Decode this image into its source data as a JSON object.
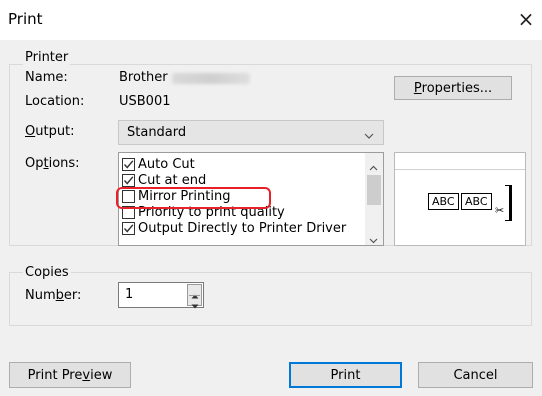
{
  "dialog": {
    "title": "Print",
    "close_glyph": "×"
  },
  "printer": {
    "group_label": "Printer",
    "name_label": "Name:",
    "name_value": "Brother",
    "location_label": "Location:",
    "location_value": "USB001",
    "properties_button": {
      "prefix": "",
      "underline": "P",
      "rest": "roperties..."
    }
  },
  "output": {
    "label": {
      "underline": "O",
      "rest": "utput:"
    },
    "selected": "Standard"
  },
  "options": {
    "label": {
      "prefix": "Op",
      "underline": "t",
      "rest": "ions:"
    },
    "items": [
      {
        "label": "Auto Cut",
        "checked": true
      },
      {
        "label": "Cut at end",
        "checked": true
      },
      {
        "label": "Mirror Printing",
        "checked": false
      },
      {
        "label": "Priority to print quality",
        "checked": false
      },
      {
        "label": "Output Directly to Printer Driver",
        "checked": true
      }
    ],
    "highlight_color": "#e8202a"
  },
  "preview": {
    "boxes": [
      "ABC",
      "ABC"
    ]
  },
  "copies": {
    "group_label": "Copies",
    "number_label": {
      "prefix": "Num",
      "underline": "b",
      "rest": "er:"
    },
    "number_value": "1"
  },
  "buttons": {
    "print_preview": {
      "prefix": "Print Pre",
      "underline": "v",
      "rest": "iew"
    },
    "print": "Print",
    "cancel": "Cancel"
  }
}
